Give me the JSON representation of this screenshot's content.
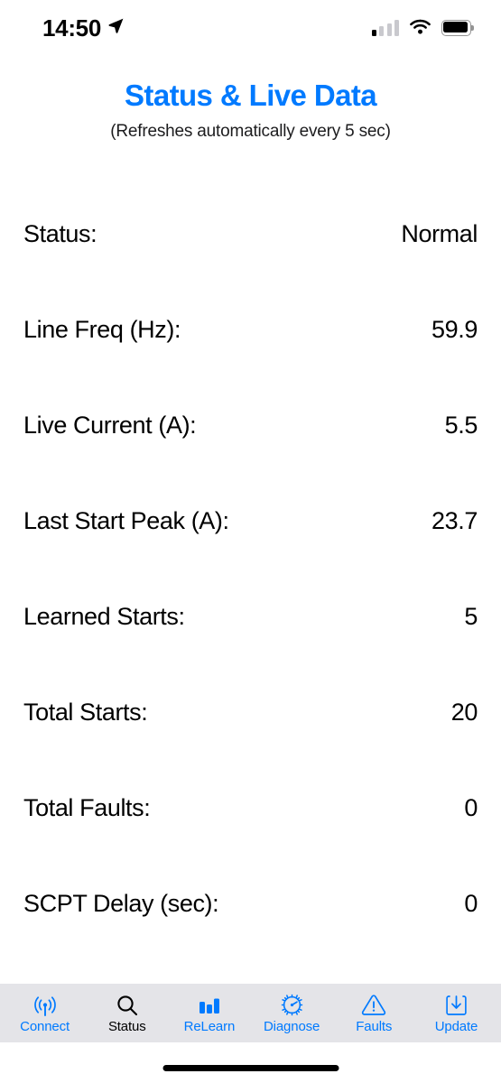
{
  "status_bar": {
    "time": "14:50",
    "location_icon": "location-arrow-icon",
    "signal_icon": "cellular-signal-icon",
    "signal_bars_filled": 1,
    "signal_bars_total": 4,
    "wifi_icon": "wifi-icon",
    "battery_icon": "battery-icon",
    "battery_level_percent": 92
  },
  "header": {
    "title": "Status & Live Data",
    "subtitle": "(Refreshes automatically every 5 sec)",
    "title_color": "#007AFF"
  },
  "main": {
    "rows": [
      {
        "label": "Status:",
        "value": "Normal"
      },
      {
        "label": "Line Freq (Hz):",
        "value": "59.9"
      },
      {
        "label": "Live Current (A):",
        "value": "5.5"
      },
      {
        "label": "Last Start Peak (A):",
        "value": "23.7"
      },
      {
        "label": "Learned Starts:",
        "value": "5"
      },
      {
        "label": "Total Starts:",
        "value": "20"
      },
      {
        "label": "Total Faults:",
        "value": "0"
      },
      {
        "label": "SCPT Delay (sec):",
        "value": "0"
      }
    ]
  },
  "tab_bar": {
    "background_color": "#E4E4E8",
    "active_color": "#000000",
    "inactive_color": "#007AFF",
    "tabs": [
      {
        "label": "Connect",
        "icon": "antenna-broadcast-icon",
        "active": false
      },
      {
        "label": "Status",
        "icon": "magnifying-glass-icon",
        "active": true
      },
      {
        "label": "ReLearn",
        "icon": "bar-chart-icon",
        "active": false
      },
      {
        "label": "Diagnose",
        "icon": "gear-gauge-icon",
        "active": false
      },
      {
        "label": "Faults",
        "icon": "warning-triangle-icon",
        "active": false
      },
      {
        "label": "Update",
        "icon": "download-tray-icon",
        "active": false
      }
    ]
  },
  "home_indicator": {
    "name": "home-indicator"
  }
}
